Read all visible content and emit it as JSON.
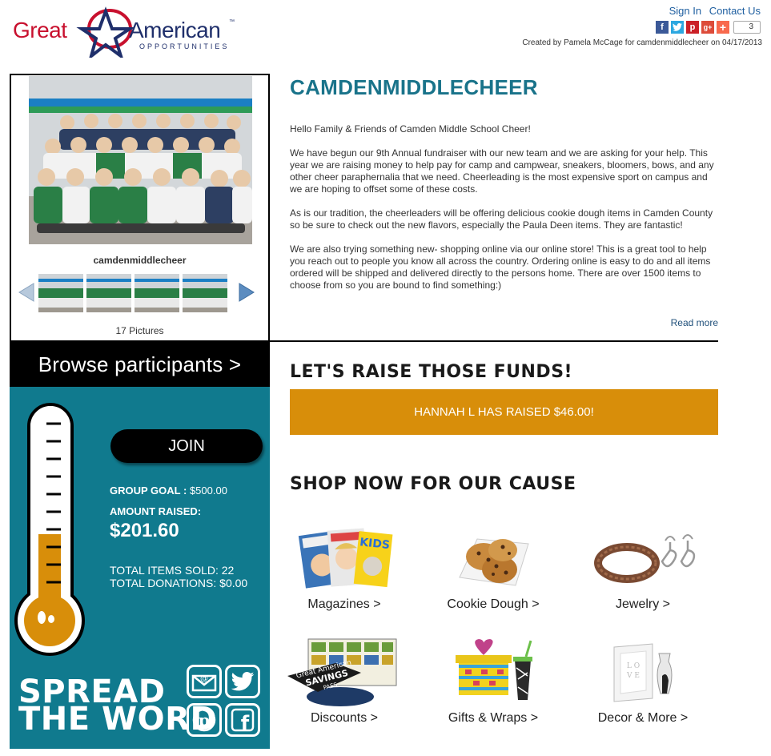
{
  "brand": {
    "logo_left": "Great",
    "logo_right": "American",
    "logo_tm": "™",
    "logo_sub": "OPPORTUNITIES"
  },
  "header": {
    "sign_in": "Sign In",
    "contact_us": "Contact Us",
    "share_count": "3",
    "created_by": "Created by Pamela McCage for camdenmiddlecheer on 04/17/2013"
  },
  "gallery": {
    "name": "camdenmiddlecheer",
    "picture_count": "17 Pictures"
  },
  "about": {
    "title": "CAMDENMIDDLECHEER",
    "paragraphs": [
      "Hello Family & Friends of Camden Middle School Cheer!",
      "We have begun our 9th Annual fundraiser with our new team and we are asking for your help. This year we are raising money to help pay for camp and campwear, sneakers, bloomers, bows, and any other cheer paraphernalia that we need. Cheerleading is the most expensive sport on campus and we are hoping to offset some of these costs.",
      "As is our tradition, the cheerleaders will be offering delicious cookie dough items in Camden County so be sure to check out the new flavors, especially the Paula Deen items. They are fantastic!",
      "We are also trying something new- shopping online via our online store! This is a great tool to help you reach out to people you know all across the country. Ordering online is easy to do and all items ordered will be shipped and delivered directly to the persons home. There are over 1500 items to choose from so you are bound to find something:)"
    ],
    "read_more": "Read more"
  },
  "panel": {
    "browse": "Browse participants >",
    "join": "JOIN",
    "goal_label": "GROUP GOAL :",
    "goal_value": "$500.00",
    "raised_label": "AMOUNT RAISED:",
    "raised_value": "$201.60",
    "items_sold": "TOTAL ITEMS SOLD: 22",
    "donations": "TOTAL DONATIONS: $0.00",
    "progress_fraction": 0.403,
    "spread_line1": "SPREAD",
    "spread_line2": "THE WORD"
  },
  "raise": {
    "title": "LET'S RAISE THOSE FUNDS!",
    "banner": "HANNAH L HAS RAISED $46.00!"
  },
  "shop": {
    "title": "SHOP NOW FOR OUR CAUSE",
    "savings_top": "Great American",
    "savings_mid": "SAVINGS",
    "savings_bot": "PASS",
    "categories": [
      {
        "label": "Magazines >"
      },
      {
        "label": "Cookie Dough >"
      },
      {
        "label": "Jewelry >"
      },
      {
        "label": "Discounts >"
      },
      {
        "label": "Gifts & Wraps >"
      },
      {
        "label": "Decor & More >"
      }
    ]
  },
  "colors": {
    "teal": "#107a8e",
    "title_teal": "#19738a",
    "orange": "#d88e0a",
    "brand_red": "#c8102e",
    "brand_navy": "#1f2f6b"
  }
}
